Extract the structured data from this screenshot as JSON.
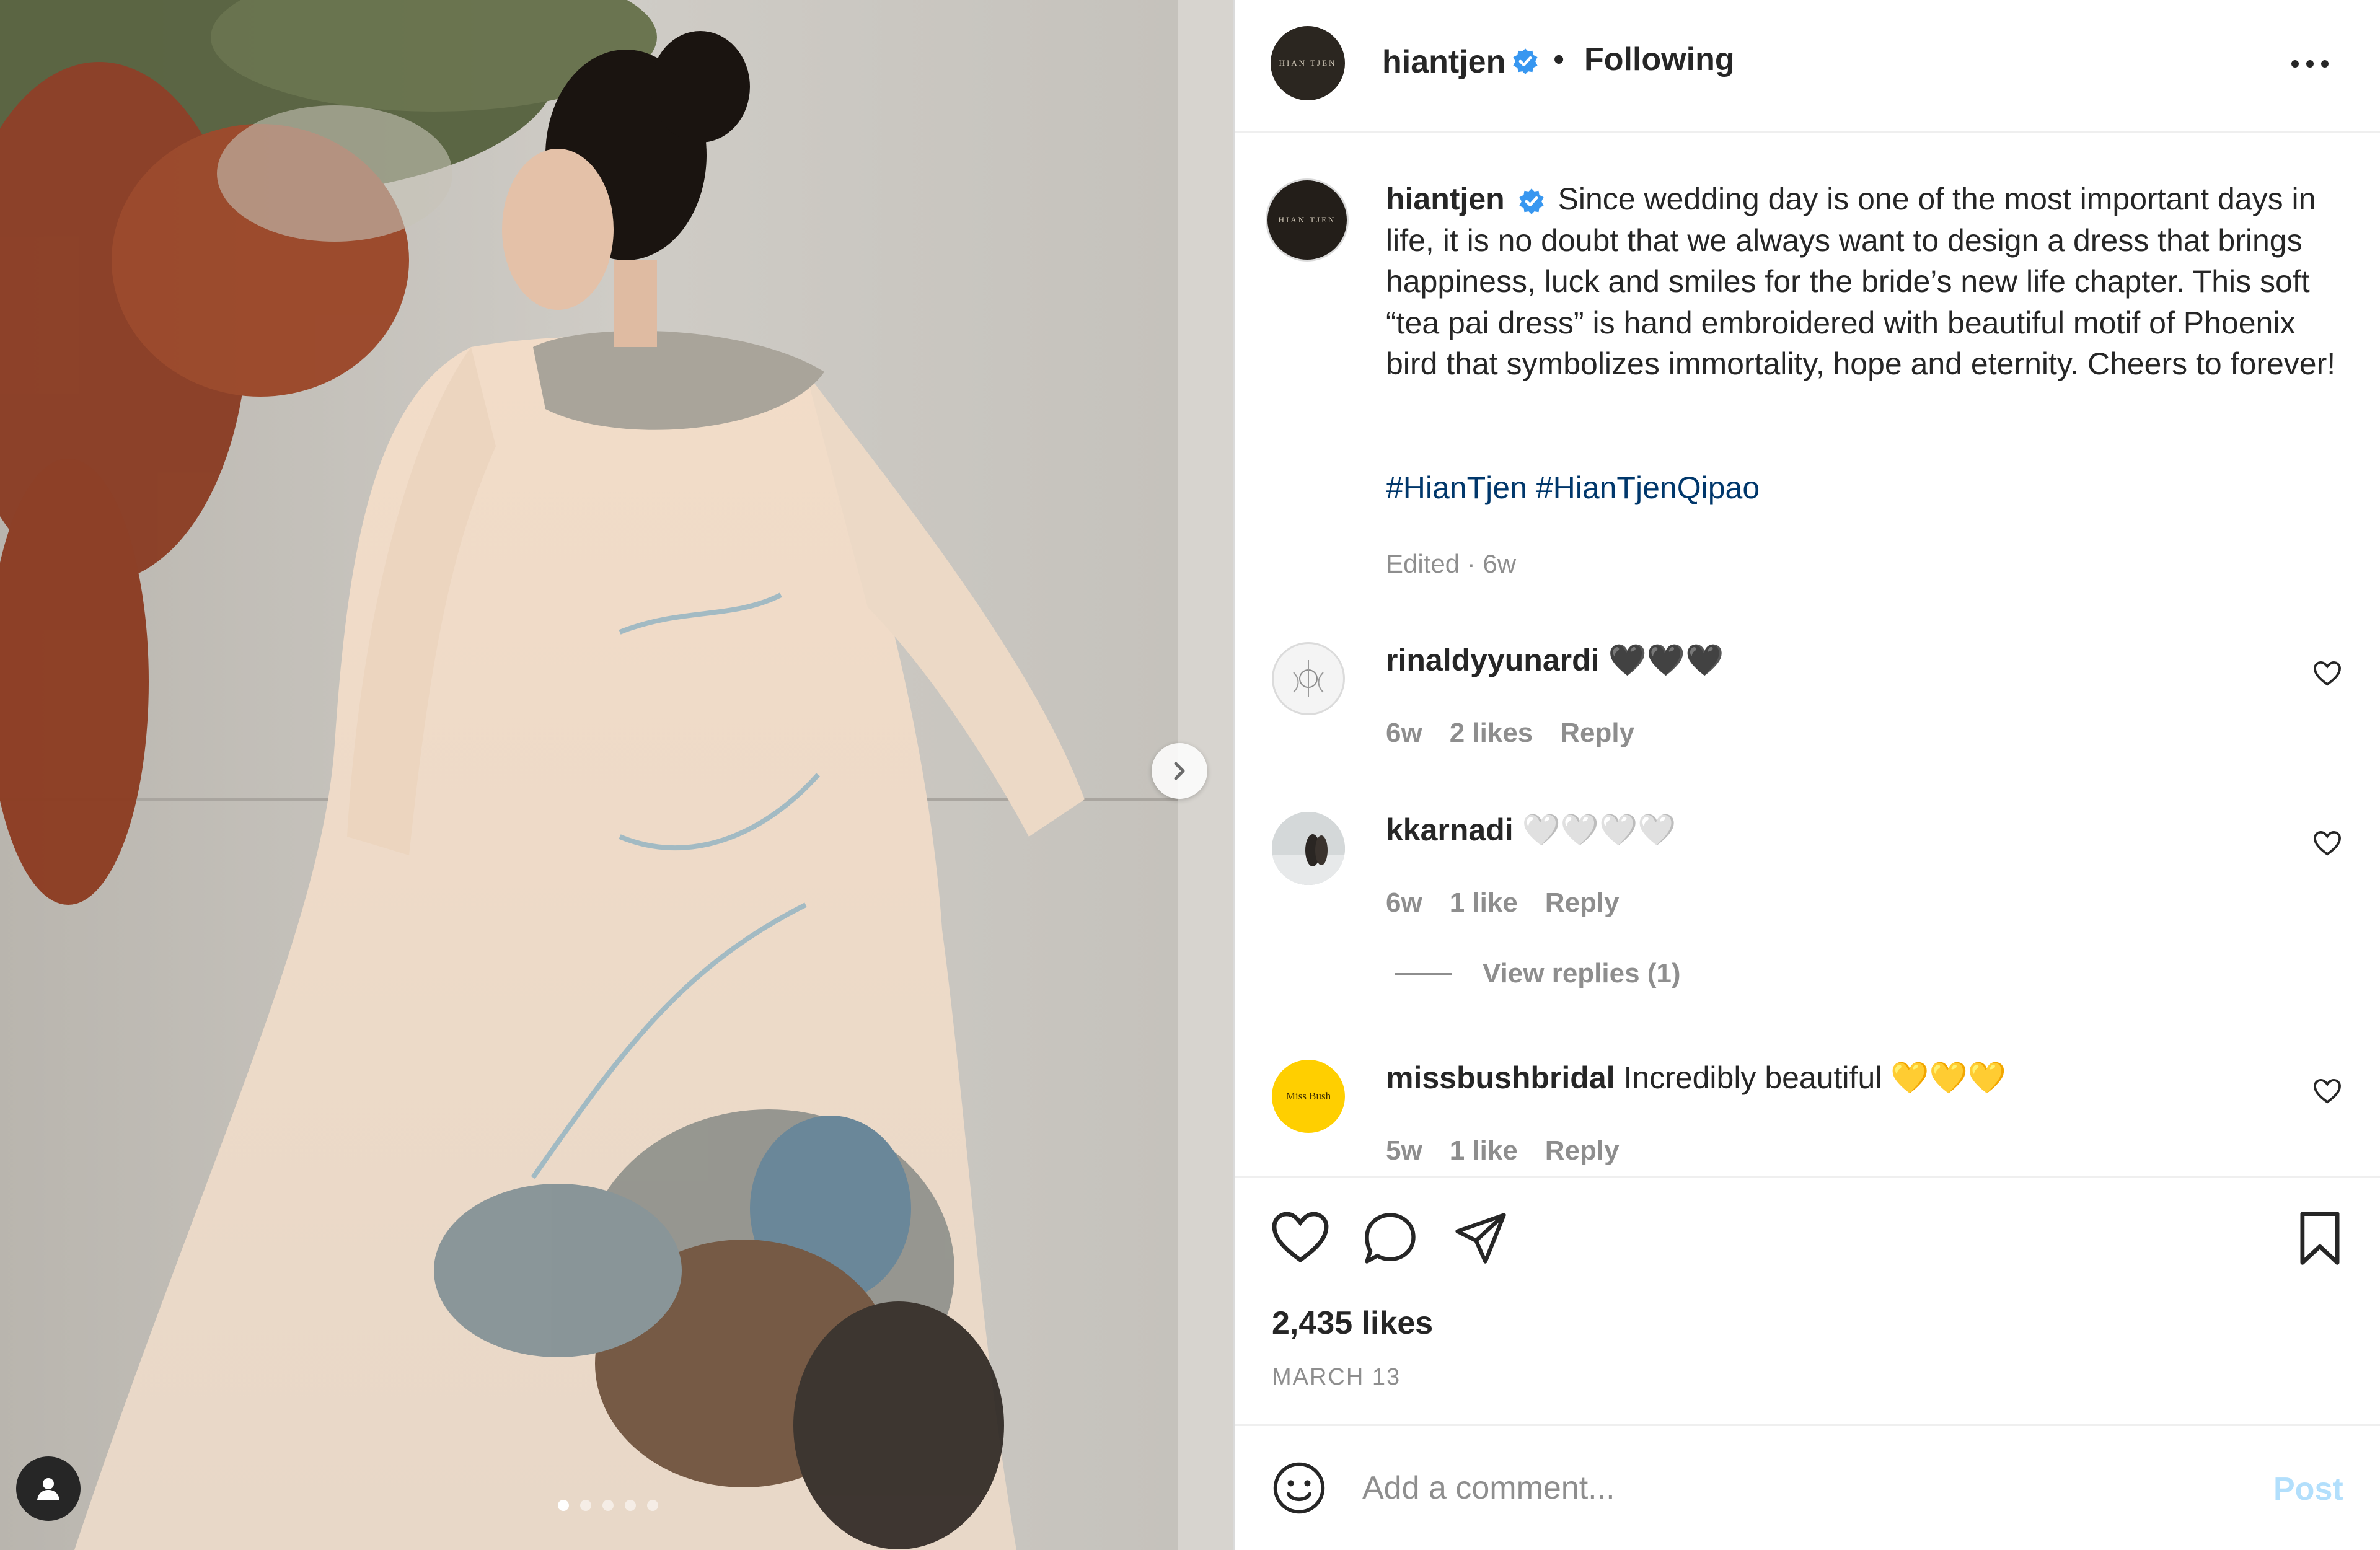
{
  "post": {
    "username": "hiantjen",
    "avatar_mark": "HIAN TJEN",
    "follow_separator": "•",
    "follow_status": "Following",
    "caption": "Since wedding day is one of the most important days in life, it is no doubt that we always want to design a dress that brings happiness, luck and smiles for the bride’s new life chapter. This soft “tea pai dress” is hand embroidered with beautiful motif of Phoenix bird that symbolizes immortality, hope and eternity. Cheers to forever!",
    "hashtags": "#HianTjen #HianTjenQipao",
    "edited_time": "Edited · 6w",
    "likes": "2,435 likes",
    "date": "MARCH 13",
    "carousel": {
      "slide_count": 5,
      "active_slide": 1
    }
  },
  "comments": [
    {
      "username": "rinaldyyunardi",
      "text": "🖤🖤🖤",
      "time": "6w",
      "likes": "2 likes",
      "reply": "Reply"
    },
    {
      "username": "kkarnadi",
      "text": "🤍🤍🤍🤍",
      "time": "6w",
      "likes": "1 like",
      "reply": "Reply"
    },
    {
      "username": "missbushbridal",
      "text": "Incredibly beautiful 💛💛💛",
      "avatar_mark": "Miss Bush",
      "time": "5w",
      "likes": "1 like",
      "reply": "Reply"
    }
  ],
  "view_replies": "View replies (1)",
  "add_comment": {
    "placeholder": "Add a comment...",
    "post_label": "Post"
  },
  "icons": {
    "verified": "verified-badge-icon",
    "more": "more-options-icon",
    "like": "heart-icon",
    "comment": "comment-bubble-icon",
    "share": "paper-plane-icon",
    "save": "bookmark-icon",
    "emoji": "smiley-icon",
    "next": "chevron-right-icon",
    "tag": "user-tag-icon"
  },
  "colors": {
    "verified": "#3897f0",
    "link": "#00376b",
    "muted": "#8e8e8e",
    "post_disabled": "#b2dffc",
    "text": "#262626"
  }
}
